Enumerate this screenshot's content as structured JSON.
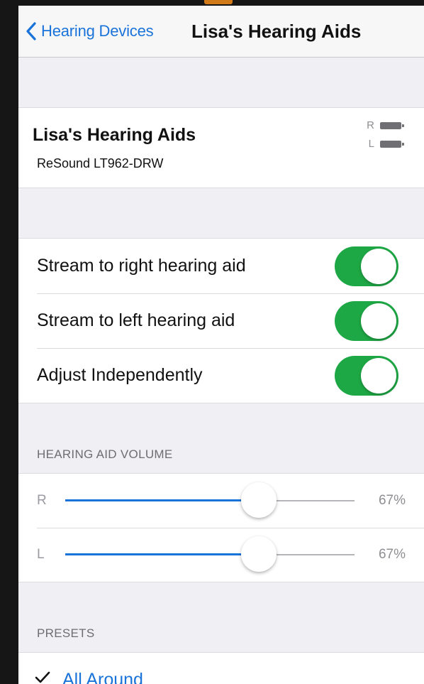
{
  "navbar": {
    "back_label": "Hearing Devices",
    "title": "Lisa's Hearing Aids"
  },
  "device": {
    "name": "Lisa's Hearing Aids",
    "model": "ReSound LT962-DRW",
    "battery": [
      {
        "side": "R"
      },
      {
        "side": "L"
      }
    ]
  },
  "toggles": [
    {
      "label": "Stream to right hearing aid",
      "on": true
    },
    {
      "label": "Stream to left hearing aid",
      "on": true
    },
    {
      "label": "Adjust Independently",
      "on": true
    }
  ],
  "volume": {
    "header": "HEARING AID VOLUME",
    "channels": [
      {
        "side": "R",
        "percent_label": "67%",
        "value": 0.67
      },
      {
        "side": "L",
        "percent_label": "67%",
        "value": 0.67
      }
    ]
  },
  "presets": {
    "header": "PRESETS",
    "items": [
      {
        "label": "All Around",
        "selected": true
      }
    ]
  },
  "colors": {
    "accent": "#1a73d9",
    "switch_on": "#1ea845",
    "frame_accent": "#d07a1a"
  }
}
